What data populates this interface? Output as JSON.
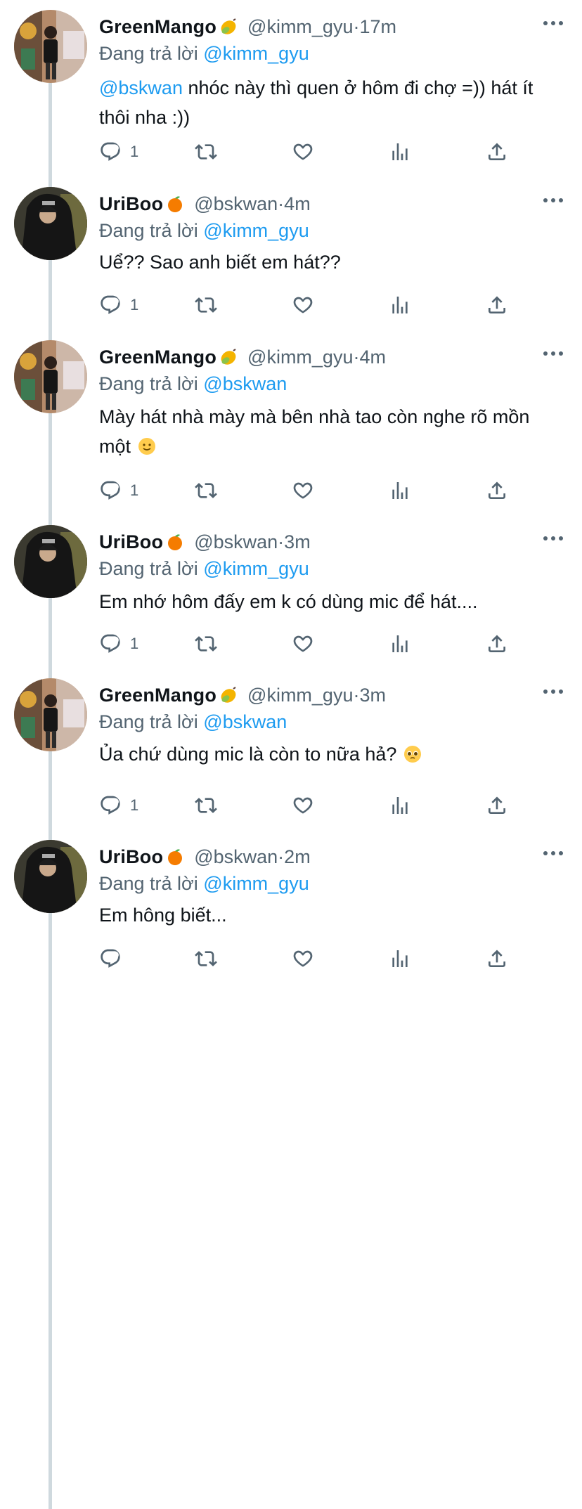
{
  "tweets": [
    {
      "name": "GreenMango",
      "name_emoji": "mango-emoji",
      "handle": "@kimm_gyu",
      "time": "17m",
      "replying_prefix": "Đang trả lời",
      "replying_to": "@kimm_gyu",
      "mention": "@bskwan",
      "text": " nhóc này thì quen ở hôm đi chợ =)) hát ít thôi nha :))",
      "reply_count": "1"
    },
    {
      "name": "UriBoo",
      "name_emoji": "tangerine-emoji",
      "handle": "@bskwan",
      "time": "4m",
      "replying_prefix": "Đang trả lời",
      "replying_to": "@kimm_gyu",
      "mention": "",
      "text": "Uể?? Sao anh biết em hát??",
      "reply_count": "1"
    },
    {
      "name": "GreenMango",
      "name_emoji": "mango-emoji",
      "handle": "@kimm_gyu",
      "time": "4m",
      "replying_prefix": "Đang trả lời",
      "replying_to": "@bskwan",
      "mention": "",
      "text": "Mày hát nhà mày mà bên nhà tao còn nghe rõ mồn một",
      "text_emoji": "slightly-smiling-face-emoji",
      "reply_count": "1"
    },
    {
      "name": "UriBoo",
      "name_emoji": "tangerine-emoji",
      "handle": "@bskwan",
      "time": "3m",
      "replying_prefix": "Đang trả lời",
      "replying_to": "@kimm_gyu",
      "mention": "",
      "text": "Em nhớ hôm đấy em k có dùng mic để hát....",
      "reply_count": "1"
    },
    {
      "name": "GreenMango",
      "name_emoji": "mango-emoji",
      "handle": "@kimm_gyu",
      "time": "3m",
      "replying_prefix": "Đang trả lời",
      "replying_to": "@bskwan",
      "mention": "",
      "text": "Ủa chứ dùng mic là còn to nữa hả?",
      "text_emoji": "pleading-face-emoji",
      "reply_count": "1"
    },
    {
      "name": "UriBoo",
      "name_emoji": "tangerine-emoji",
      "handle": "@bskwan",
      "time": "2m",
      "replying_prefix": "Đang trả lời",
      "replying_to": "@kimm_gyu",
      "mention": "",
      "text": "Em hông biết...",
      "reply_count": ""
    }
  ],
  "separator": " · ",
  "icons": {
    "more": "more-icon",
    "reply": "reply-icon",
    "retweet": "retweet-icon",
    "like": "like-icon",
    "analytics": "analytics-icon",
    "share": "share-icon"
  },
  "colors": {
    "link": "#1d9bf0",
    "secondary": "#536471",
    "text": "#0f1419",
    "thread_line": "#cfd9de"
  }
}
